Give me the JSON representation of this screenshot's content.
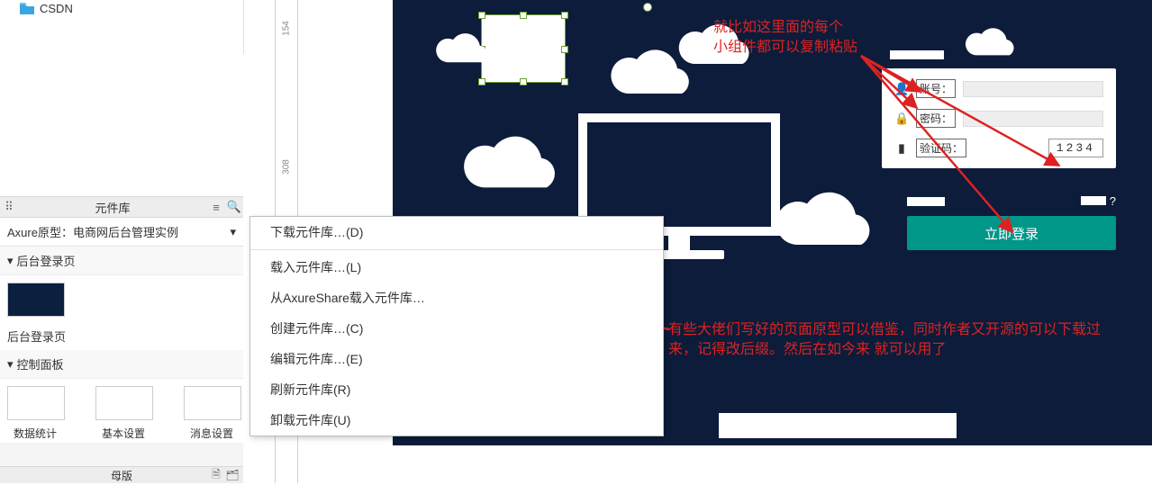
{
  "sidebar": {
    "folder_name": "CSDN",
    "library_panel_title": "元件库",
    "library_dropdown": "Axure原型：电商网后台管理实例",
    "section_login": "后台登录页",
    "login_caption": "后台登录页",
    "section_control": "控制面板",
    "thumbs": [
      {
        "caption": "数据统计"
      },
      {
        "caption": "基本设置"
      },
      {
        "caption": "消息设置"
      }
    ],
    "master_bar": "母版"
  },
  "ruler_ticks": [
    "154",
    "308"
  ],
  "menu": {
    "download": "下载元件库…(D)",
    "load": "载入元件库…(L)",
    "load_share": "从AxureShare载入元件库…",
    "create": "创建元件库…(C)",
    "edit": "编辑元件库…(E)",
    "refresh": "刷新元件库(R)",
    "unload": "卸载元件库(U)"
  },
  "login": {
    "account_label": "账号：",
    "password_label": "密码：",
    "captcha_label": "验证码：",
    "captcha_value": "1234",
    "question": "?",
    "submit": "立即登录"
  },
  "annotations": {
    "top1": "就比如这里面的每个",
    "top2": "小组件都可以复制粘贴",
    "bottom": "有些大佬们写好的页面原型可以借鉴，同时作者又开源的可以下载过来，记得改后缀。然后在如今来  就可以用了"
  }
}
